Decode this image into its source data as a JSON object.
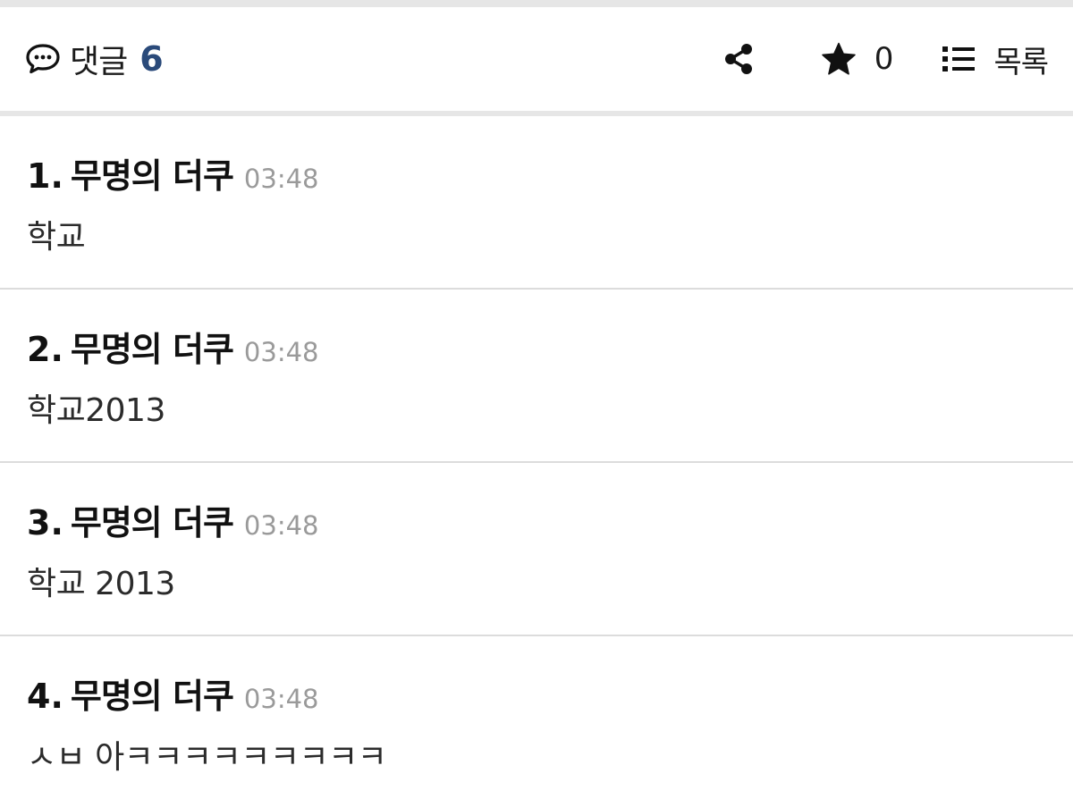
{
  "header": {
    "comment_label": "댓글",
    "comment_count": "6",
    "star_count": "0",
    "list_label": "목록",
    "icons": {
      "comment": "speech-bubble-icon",
      "share": "share-icon",
      "star": "star-icon",
      "list": "list-icon"
    }
  },
  "colors": {
    "accent": "#2a4a7a",
    "timestamp": "#9a9a9a",
    "divider": "#dcdcdc"
  },
  "comments": [
    {
      "number": "1.",
      "author": "무명의 더쿠",
      "time": "03:48",
      "body": "학교"
    },
    {
      "number": "2.",
      "author": "무명의 더쿠",
      "time": "03:48",
      "body": "학교2013"
    },
    {
      "number": "3.",
      "author": "무명의 더쿠",
      "time": "03:48",
      "body": "학교 2013"
    },
    {
      "number": "4.",
      "author": "무명의 더쿠",
      "time": "03:48",
      "body": "ㅅㅂ 아ㅋㅋㅋㅋㅋㅋㅋㅋㅋ"
    }
  ]
}
